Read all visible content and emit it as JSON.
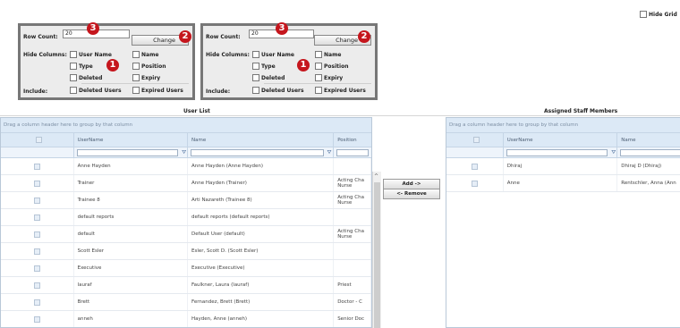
{
  "hide_grid": "Hide Grid",
  "panels": [
    {
      "row_count_label": "Row Count:",
      "row_count_value": "20",
      "change_label": "Change",
      "hide_columns_label": "Hide Columns:",
      "include_label": "Include:",
      "options": {
        "user_name": "User Name",
        "name": "Name",
        "type": "Type",
        "position": "Position",
        "deleted": "Deleted",
        "expiry": "Expiry",
        "deleted_users": "Deleted Users",
        "expired_users": "Expired Users"
      },
      "badges": {
        "row_count": "3",
        "change": "2",
        "columns": "1"
      }
    },
    {
      "row_count_label": "Row Count:",
      "row_count_value": "20",
      "change_label": "Change",
      "hide_columns_label": "Hide Columns:",
      "include_label": "Include:",
      "options": {
        "user_name": "User Name",
        "name": "Name",
        "type": "Type",
        "position": "Position",
        "deleted": "Deleted",
        "expiry": "Expiry",
        "deleted_users": "Deleted Users",
        "expired_users": "Expired Users"
      },
      "badges": {
        "row_count": "3",
        "change": "2",
        "columns": "1"
      }
    }
  ],
  "user_list": {
    "title": "User List",
    "group_hint": "Drag a column header here to group by that column",
    "columns": {
      "username": "UserName",
      "name": "Name",
      "position": "Position"
    },
    "rows": [
      {
        "username": "Anne Hayden",
        "name": "Anne Hayden (Anne Hayden)",
        "position": ""
      },
      {
        "username": "Trainer",
        "name": "Anne Hayden (Trainer)",
        "position": "Acting Cha Nurse"
      },
      {
        "username": "Trainee 8",
        "name": "Arti Nazareth (Trainee 8)",
        "position": "Acting Cha Nurse"
      },
      {
        "username": "default reports",
        "name": "default reports (default reports)",
        "position": ""
      },
      {
        "username": "default",
        "name": "Default User (default)",
        "position": "Acting Cha Nurse"
      },
      {
        "username": "Scott Esler",
        "name": "Esler, Scott D. (Scott Esler)",
        "position": ""
      },
      {
        "username": "Executive",
        "name": "Executive (Executive)",
        "position": ""
      },
      {
        "username": "lauraf",
        "name": "Faulkner, Laura (lauraf)",
        "position": "Priest"
      },
      {
        "username": "Brett",
        "name": "Fernandez, Brett (Brett)",
        "position": "Doctor - C"
      },
      {
        "username": "anneh",
        "name": "Hayden, Anne (anneh)",
        "position": "Senior Doc"
      }
    ]
  },
  "assigned": {
    "title": "Assigned Staff Members",
    "group_hint": "Drag a column header here to group by that column",
    "columns": {
      "username": "UserName",
      "name": "Name"
    },
    "rows": [
      {
        "username": "Dhiraj",
        "name": "Dhiraj D (Dhiraj)"
      },
      {
        "username": "Anne",
        "name": "Rentschler, Anna (Ann"
      }
    ]
  },
  "buttons": {
    "add": "Add ->",
    "remove": "<- Remove"
  },
  "colors": {
    "badge": "#c5161d",
    "grid_header": "#dce9f6"
  }
}
